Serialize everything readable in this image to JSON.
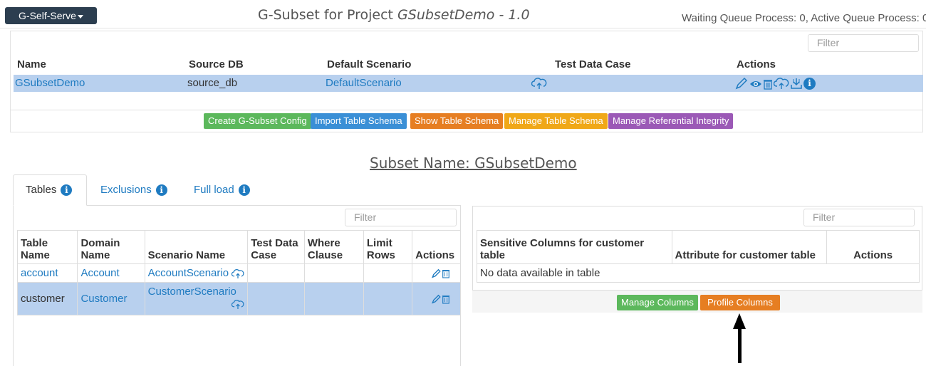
{
  "header": {
    "brand_label": "G-Self-Serve",
    "title_prefix": "G-Subset for Project ",
    "project_name": "GSubsetDemo - 1.0",
    "queue_status": "Waiting Queue Process: 0, Active Queue Process: 0"
  },
  "projects": {
    "filter_placeholder": "Filter",
    "columns": [
      "Name",
      "Source DB",
      "Default Scenario",
      "Test Data Case",
      "Actions"
    ],
    "row": {
      "name": "GSubsetDemo",
      "source_db": "source_db",
      "default_scenario": "DefaultScenario"
    },
    "action_icons": [
      "pencil-icon",
      "eye-icon",
      "trash-icon",
      "cloud-upload-icon",
      "download-tray-icon",
      "info-icon"
    ]
  },
  "config_buttons": [
    {
      "label": "Create G-Subset Config",
      "color": "#5cb85c"
    },
    {
      "label": "Import Table Schema",
      "color": "#3a8fd6"
    },
    {
      "label": "Show Table Schema",
      "color": "#e67e22"
    },
    {
      "label": "Manage Table Schema",
      "color": "#f0a818"
    },
    {
      "label": "Manage Referential Integrity",
      "color": "#9b59b6"
    }
  ],
  "subset": {
    "title": "Subset Name: GSubsetDemo"
  },
  "tabs": [
    {
      "label": "Tables",
      "active": true
    },
    {
      "label": "Exclusions",
      "active": false
    },
    {
      "label": "Full load",
      "active": false
    }
  ],
  "tables_panel": {
    "filter_placeholder": "Filter",
    "columns": {
      "table_name_1": "Table",
      "table_name_2": "Name",
      "domain_name_1": "Domain",
      "domain_name_2": "Name",
      "scenario_name": "Scenario Name",
      "test_data_1": "Test Data",
      "test_data_2": "Case",
      "where_1": "Where",
      "where_2": "Clause",
      "limit_1": "Limit",
      "limit_2": "Rows",
      "actions": "Actions"
    },
    "rows": [
      {
        "table": "account",
        "domain": "Account",
        "scenario": "AccountScenario"
      },
      {
        "table": "customer",
        "domain": "Customer",
        "scenario": "CustomerScenario"
      }
    ]
  },
  "columns_panel": {
    "filter_placeholder": "Filter",
    "col_sensitive_1": "Sensitive Columns for customer",
    "col_sensitive_2": "table",
    "col_attribute": "Attribute for customer table",
    "col_actions": "Actions",
    "empty_message": "No data available in table",
    "manage_label": "Manage Columns",
    "profile_label": "Profile Columns"
  },
  "colors": {
    "navy": "#2c3e50",
    "link": "#1f7bc1",
    "selected_row": "#b8d0ee",
    "green": "#5cb85c",
    "orange": "#e67e22"
  }
}
